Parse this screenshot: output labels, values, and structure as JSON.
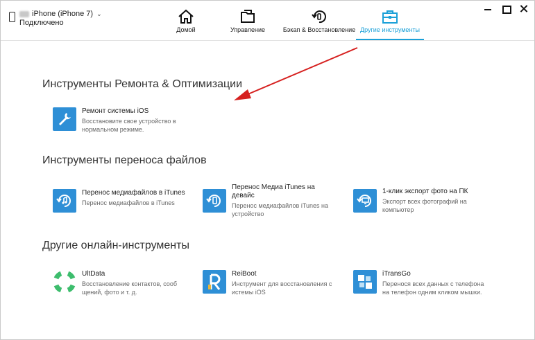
{
  "device": {
    "name": "iPhone (iPhone 7)",
    "status": "Подключено"
  },
  "nav": {
    "items": [
      {
        "label": "Домой",
        "icon": "home-icon"
      },
      {
        "label": "Управление",
        "icon": "folder-icon"
      },
      {
        "label": "Бэкап & Восстановление",
        "icon": "backup-restore-icon"
      },
      {
        "label": "Другие инструменты",
        "icon": "toolbox-icon",
        "active": true
      }
    ]
  },
  "sections": {
    "repair": {
      "title": "Инструменты Ремонта & Оптимизации",
      "tools": [
        {
          "name": "Ремонт системы iOS",
          "desc_lines": [
            "Восстановите свое устройство в",
            "нормальном режиме."
          ]
        }
      ]
    },
    "transfer": {
      "title": "Инструменты переноса файлов",
      "tools": [
        {
          "name": "Перенос медиафайлов в iTunes",
          "desc_lines": [
            "Перенос медиафайлов в iTunes"
          ]
        },
        {
          "name_lines": [
            "Перенос Медиа iTunes на",
            "девайс"
          ],
          "desc_lines": [
            "Перенос медиафайлов iTunes на",
            "устройство"
          ]
        },
        {
          "name": "1-клик экспорт фото на ПК",
          "desc_lines": [
            "Экспорт всех фотографий на",
            "компьютер"
          ]
        }
      ]
    },
    "online": {
      "title": "Другие онлайн-инструменты",
      "tools": [
        {
          "name": "UltData",
          "desc_lines": [
            "Восстановление контактов,  сооб",
            "щений, фото и т. д."
          ]
        },
        {
          "name": "ReiBoot",
          "desc_lines": [
            "Инструмент для восстановления с",
            "истемы iOS"
          ]
        },
        {
          "name": "iTransGo",
          "desc_lines": [
            "Перенося всех данных с телефона",
            "на телефон одним кликом мышки."
          ]
        }
      ]
    }
  },
  "colors": {
    "accent": "#1aa0d8",
    "tile_blue": "#2e8fd6",
    "ultdata_green": "#3dbd6d",
    "arrow_red": "#d6201f"
  }
}
